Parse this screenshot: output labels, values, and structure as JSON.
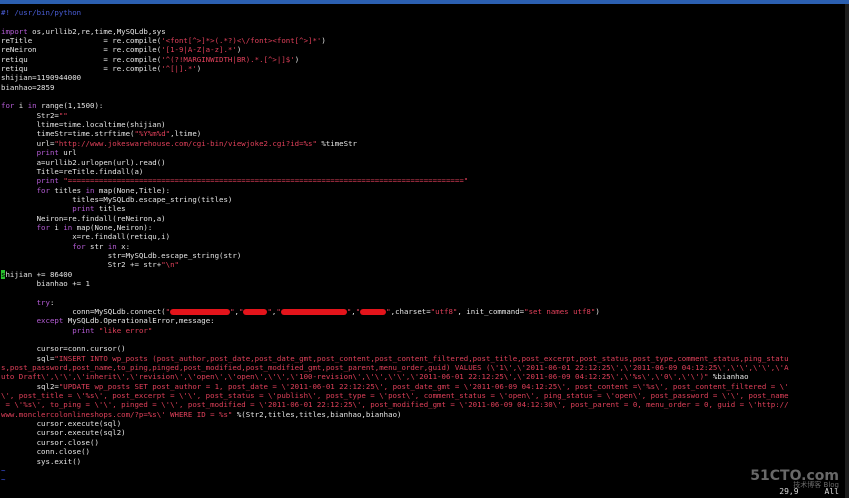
{
  "lines": [
    [
      {
        "c": "cmt",
        "t": "#! /usr/bin/python"
      }
    ],
    [],
    [
      {
        "c": "kw",
        "t": "import"
      },
      {
        "t": " os,urllib2,re,time,MySQLdb,sys"
      }
    ],
    [
      {
        "t": "reTitle                = re.compile("
      },
      {
        "c": "str",
        "t": "'<font[^>]*>(.*?)<\\/font><font[^>]*'"
      },
      {
        "t": ")"
      }
    ],
    [
      {
        "t": "reNeiron               = re.compile("
      },
      {
        "c": "str",
        "t": "'[1-9|A-Z|a-z].*'"
      },
      {
        "t": ")"
      }
    ],
    [
      {
        "t": "retiqu                 = re.compile("
      },
      {
        "c": "str",
        "t": "'^(?!MARGINWIDTH|BR).*.[^>|]$'"
      },
      {
        "t": ")"
      }
    ],
    [
      {
        "t": "retiqu                 = re.compile("
      },
      {
        "c": "str",
        "t": "'^[|].*'"
      },
      {
        "t": ")"
      }
    ],
    [
      {
        "t": "shijian=1190944000"
      }
    ],
    [
      {
        "t": "bianhao=2859"
      }
    ],
    [],
    [
      {
        "c": "kw",
        "t": "for"
      },
      {
        "t": " i "
      },
      {
        "c": "kw",
        "t": "in"
      },
      {
        "t": " range(1,1500):"
      }
    ],
    [
      {
        "t": "        Str2="
      },
      {
        "c": "str",
        "t": "\"\""
      }
    ],
    [
      {
        "t": "        ltime=time.localtime(shijian)"
      }
    ],
    [
      {
        "t": "        timeStr=time.strftime("
      },
      {
        "c": "str",
        "t": "\"%Y%m%d\""
      },
      {
        "t": ",ltime)"
      }
    ],
    [
      {
        "t": "        url="
      },
      {
        "c": "str",
        "t": "\"http://www.jokeswarehouse.com/cgi-bin/viewjoke2.cgi?id=%s\""
      },
      {
        "t": " %timeStr"
      }
    ],
    [
      {
        "t": "        "
      },
      {
        "c": "kw",
        "t": "print"
      },
      {
        "t": " url"
      }
    ],
    [
      {
        "t": "        a=urllib2.urlopen(url).read()"
      }
    ],
    [
      {
        "t": "        Title=reTitle.findall(a)"
      }
    ],
    [
      {
        "t": "        "
      },
      {
        "c": "kw",
        "t": "print"
      },
      {
        "t": " "
      },
      {
        "c": "str",
        "t": "\"=========================================================================================\""
      }
    ],
    [
      {
        "t": "        "
      },
      {
        "c": "kw",
        "t": "for"
      },
      {
        "t": " titles "
      },
      {
        "c": "kw",
        "t": "in"
      },
      {
        "t": " map(None,Title):"
      }
    ],
    [
      {
        "t": "                titles=MySQLdb.escape_string(titles)"
      }
    ],
    [
      {
        "t": "                "
      },
      {
        "c": "kw",
        "t": "print"
      },
      {
        "t": " titles"
      }
    ],
    [
      {
        "t": "        Neiron=re.findall(reNeiron,a)"
      }
    ],
    [
      {
        "t": "        "
      },
      {
        "c": "kw",
        "t": "for"
      },
      {
        "t": " i "
      },
      {
        "c": "kw",
        "t": "in"
      },
      {
        "t": " map(None,Neiron):"
      }
    ],
    [
      {
        "t": "                x=re.findall(retiqu,i)"
      }
    ],
    [
      {
        "t": "                "
      },
      {
        "c": "kw",
        "t": "for"
      },
      {
        "t": " str "
      },
      {
        "c": "kw",
        "t": "in"
      },
      {
        "t": " x:"
      }
    ],
    [
      {
        "t": "                        str=MySQLdb.escape_string(str)"
      }
    ],
    [
      {
        "t": "                        Str2 += str+"
      },
      {
        "c": "str",
        "t": "\"\\n\""
      }
    ],
    [
      {
        "c": "cursor",
        "t": "s"
      },
      {
        "t": "hijian += 86400"
      }
    ],
    [
      {
        "t": "        bianhao += 1"
      }
    ],
    [],
    [
      {
        "t": "        "
      },
      {
        "c": "kw",
        "t": "try"
      },
      {
        "t": ":"
      }
    ],
    [
      {
        "t": "                conn=MySQLdb.connect("
      },
      {
        "c": "str",
        "t": "\""
      },
      {
        "c": "red",
        "w": 60
      },
      {
        "c": "str",
        "t": "\""
      },
      {
        "t": ","
      },
      {
        "c": "str",
        "t": "\""
      },
      {
        "c": "red",
        "w": 24
      },
      {
        "c": "str",
        "t": "\""
      },
      {
        "t": ","
      },
      {
        "c": "str",
        "t": "\""
      },
      {
        "c": "red",
        "w": 66
      },
      {
        "c": "str",
        "t": "\""
      },
      {
        "t": ","
      },
      {
        "c": "str",
        "t": "\""
      },
      {
        "c": "red",
        "w": 26
      },
      {
        "c": "str",
        "t": "\""
      },
      {
        "t": ",charset="
      },
      {
        "c": "str",
        "t": "\"utf8\""
      },
      {
        "t": ", init_command="
      },
      {
        "c": "str",
        "t": "\"set names utf8\""
      },
      {
        "t": ")"
      }
    ],
    [
      {
        "t": "        "
      },
      {
        "c": "kw",
        "t": "except"
      },
      {
        "t": " MySQLdb.OperationalError,message:"
      }
    ],
    [
      {
        "t": "                "
      },
      {
        "c": "kw",
        "t": "print"
      },
      {
        "t": " "
      },
      {
        "c": "str",
        "t": "\"like error\""
      }
    ],
    [],
    [
      {
        "t": "        cursor=conn.cursor()"
      }
    ],
    [
      {
        "t": "        sql="
      },
      {
        "c": "str",
        "t": "\"INSERT INTO wp_posts (post_author,post_date,post_date_gmt,post_content,post_content_filtered,post_title,post_excerpt,post_status,post_type,comment_status,ping_statu"
      }
    ],
    [
      {
        "c": "str",
        "t": "s,post_password,post_name,to_ping,pinged,post_modified,post_modified_gmt,post_parent,menu_order,guid) VALUES (\\'1\\',\\'2011-06-01 22:12:25\\',\\'2011-06-09 04:12:25\\',\\'\\',\\'\\',\\'A"
      }
    ],
    [
      {
        "c": "str",
        "t": "uto Draft\\',\\'\\',\\'inherit\\',\\'revision\\',\\'open\\',\\'open\\',\\'\\',\\'100-revision\\',\\'\\',\\'\\',\\'2011-06-01 22:12:25\\',\\'2011-06-09 04:12:25\\',\\'%s\\',\\'0\\',\\'\\')\""
      },
      {
        "t": " %bianhao"
      }
    ],
    [
      {
        "t": "        sql2="
      },
      {
        "c": "str",
        "t": "\"UPDATE wp_posts SET post_author = 1, post_date = \\'2011-06-01 22:12:25\\', post_date_gmt = \\'2011-06-09 04:12:25\\', post_content =\\'%s\\', post_content_filtered = \\'"
      }
    ],
    [
      {
        "c": "str",
        "t": "\\', post_title = \\'%s\\', post_excerpt = \\'\\', post_status = \\'publish\\', post_type = \\'post\\', comment_status = \\'open\\', ping_status = \\'open\\', post_password = \\'\\', post_name"
      }
    ],
    [
      {
        "c": "str",
        "t": " = \\'%s\\', to_ping = \\'\\', pinged = \\'\\', post_modified = \\'2011-06-01 22:12:25\\', post_modified_gmt = \\'2011-06-09 04:12:30\\', post_parent = 0, menu_order = 0, guid = \\'http://"
      }
    ],
    [
      {
        "c": "str",
        "t": "www.monclercolonlineshops.com/?p=%s\\' WHERE ID = %s\""
      },
      {
        "t": " %(Str2,titles,titles,bianhao,bianhao)"
      }
    ],
    [
      {
        "t": "        cursor.execute(sql)"
      }
    ],
    [
      {
        "t": "        cursor.execute(sql2)"
      }
    ],
    [
      {
        "t": "        cursor.close()"
      }
    ],
    [
      {
        "t": "        conn.close()"
      }
    ],
    [
      {
        "t": "        sys.exit()"
      }
    ],
    [
      {
        "c": "tilde",
        "t": "~"
      }
    ],
    [
      {
        "c": "tilde",
        "t": "~"
      }
    ]
  ],
  "status": {
    "position": "29,9",
    "scroll": "All"
  },
  "watermark": {
    "brand": "51CTO.com",
    "sub": "技术博客  Blog"
  }
}
